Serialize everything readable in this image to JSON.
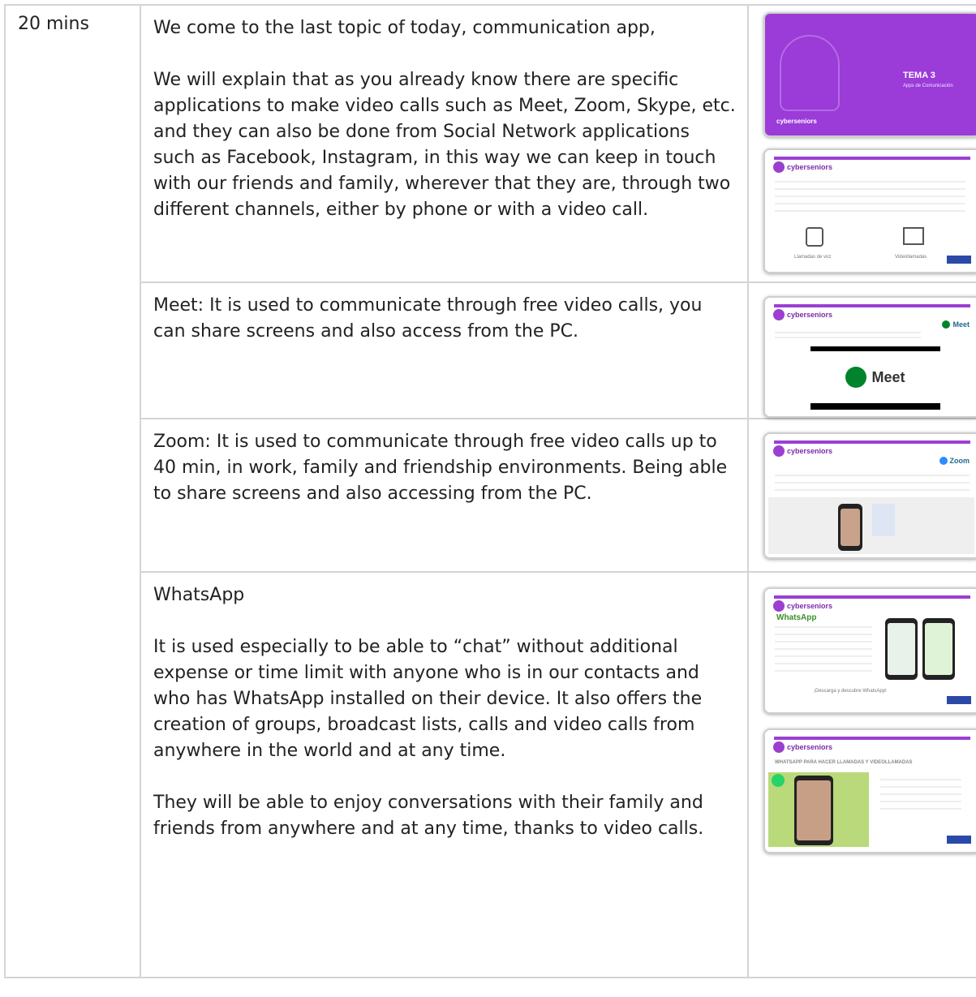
{
  "time": "20 mins",
  "rows": [
    {
      "paragraphs": [
        "We come to the last topic of today, communication app,",
        "We will explain that as you already know there are specific applications to make video calls such as Meet, Zoom, Skype, etc. and they can also be done from Social Network applications such as Facebook, Instagram, in this way we can keep in touch with our friends and family, wherever that they are, through two different channels, either by phone or with a video call."
      ]
    },
    {
      "paragraphs": [
        "Meet: It is used to communicate through free video calls, you can share screens and also access from the PC."
      ]
    },
    {
      "paragraphs": [
        "Zoom: It is used to communicate through free video calls up to 40 min, in work, family and friendship environments. Being able to share screens and also accessing from the PC."
      ]
    },
    {
      "paragraphs": [
        "WhatsApp",
        "It is used especially to be able to “chat” without additional expense or time limit with anyone who is in our contacts and who has WhatsApp installed on their device. It also offers the creation of groups, broadcast lists, calls and video calls from anywhere in the world and at any time.",
        "They will be able to enjoy conversations with their family and friends from anywhere and at any time, thanks to video calls."
      ]
    }
  ],
  "slides": {
    "title_slide": {
      "heading": "TEMA 3",
      "subheading": "Apps de Comunicación",
      "brand": "cyberseniors"
    },
    "intro_slide": {
      "brand": "cyberseniors",
      "caption_left": "Llamadas de voz",
      "caption_right": "Videollamadas"
    },
    "meet_slide": {
      "brand": "cyberseniors",
      "tag": "Meet",
      "logo_word": "Meet"
    },
    "zoom_slide": {
      "brand": "cyberseniors",
      "tag": "Zoom"
    },
    "whatsapp_slide": {
      "brand": "cyberseniors",
      "title": "WhatsApp",
      "footer": "¡Descarga y descubre WhatsApp!"
    },
    "whatsapp_calls_slide": {
      "brand": "cyberseniors",
      "heading": "WHATSAPP PARA HACER LLAMADAS Y VIDEOLLAMADAS"
    }
  },
  "colors": {
    "brand_purple": "#9b3bd8",
    "border": "#d4d4d4",
    "whatsapp_green": "#25d366"
  }
}
